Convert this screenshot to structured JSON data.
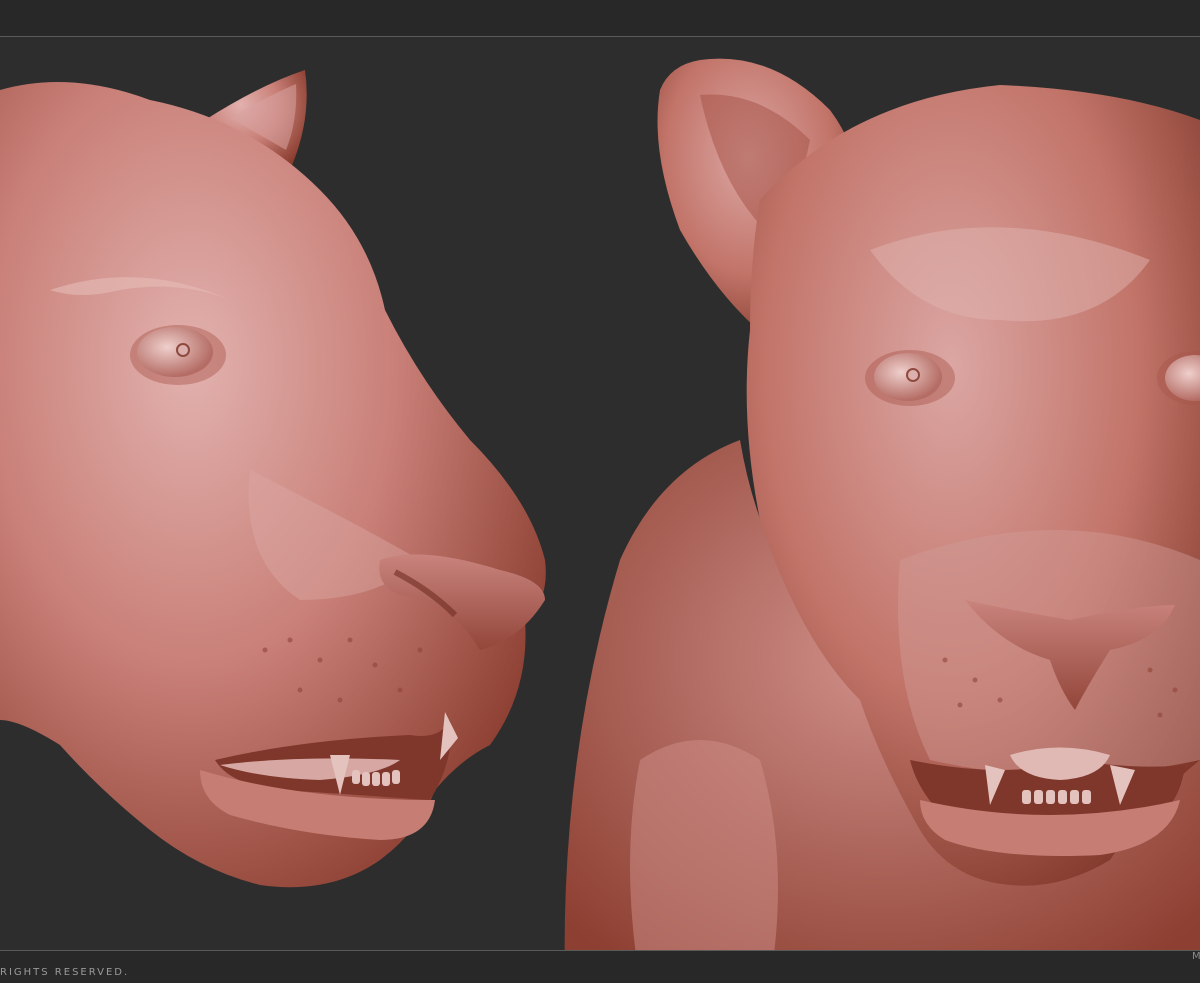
{
  "footer": {
    "copyright": "RIGHTS RESERVED.",
    "corner_mark": "M"
  },
  "viewports": [
    {
      "view": "side",
      "subject": "lioness head sculpt"
    },
    {
      "view": "front",
      "subject": "lioness head and body sculpt"
    }
  ],
  "colors": {
    "background": "#2d2d2d",
    "bars": "#282828",
    "rule": "#5a5a5a",
    "clay_light": "#d9a2a0",
    "clay_mid": "#bf7066",
    "clay_dark": "#7a3528"
  }
}
